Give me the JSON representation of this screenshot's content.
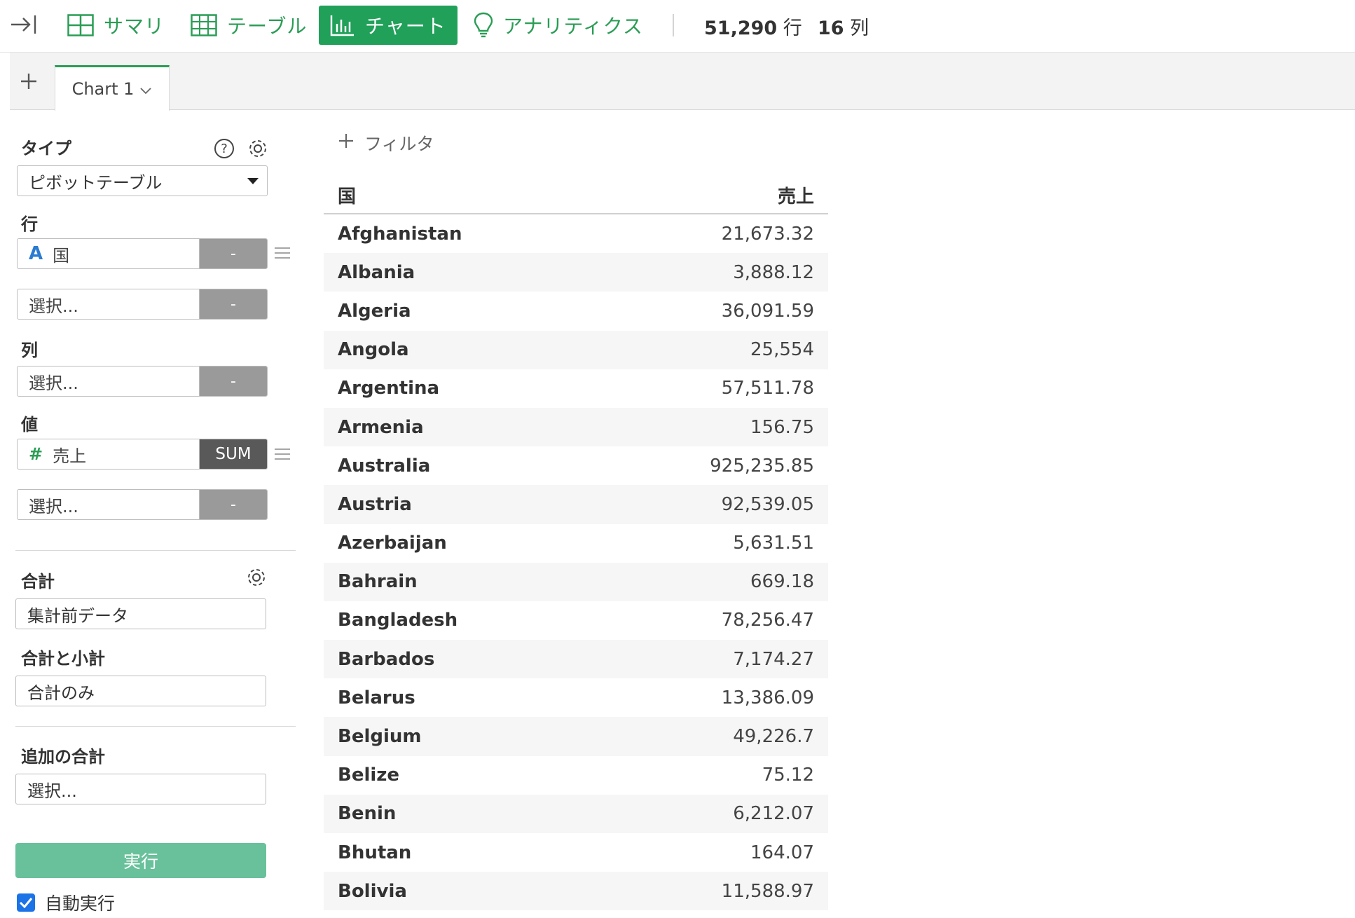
{
  "toolbar": {
    "nav": [
      {
        "label": "サマリ",
        "icon": "summary-grid-icon"
      },
      {
        "label": "テーブル",
        "icon": "table-grid-icon"
      },
      {
        "label": "チャート",
        "icon": "bar-chart-icon"
      },
      {
        "label": "アナリティクス",
        "icon": "lightbulb-icon"
      }
    ],
    "rows_count": "51,290",
    "rows_unit": "行",
    "cols_count": "16",
    "cols_unit": "列",
    "accent_color": "#21a05a"
  },
  "tabs": {
    "active_label": "Chart 1"
  },
  "panel": {
    "type_label": "タイプ",
    "type_value": "ピボットテーブル",
    "rows_label": "行",
    "row_field": {
      "name": "国",
      "type_glyph": "A",
      "agg": "-"
    },
    "row_empty": {
      "placeholder": "選択...",
      "agg": "-"
    },
    "cols_label": "列",
    "col_empty": {
      "placeholder": "選択...",
      "agg": "-"
    },
    "values_label": "値",
    "value_field": {
      "name": "売上",
      "type_glyph": "#",
      "agg": "SUM"
    },
    "value_empty": {
      "placeholder": "選択...",
      "agg": "-"
    },
    "total_label": "合計",
    "total_value": "集計前データ",
    "subtotal_label": "合計と小計",
    "subtotal_value": "合計のみ",
    "extra_total_label": "追加の合計",
    "extra_total_placeholder": "選択...",
    "run_label": "実行",
    "auto_run_label": "自動実行",
    "auto_run_checked": true
  },
  "main": {
    "filter_label": "フィルタ",
    "table": {
      "headers": [
        "国",
        "売上"
      ],
      "rows": [
        [
          "Afghanistan",
          "21,673.32"
        ],
        [
          "Albania",
          "3,888.12"
        ],
        [
          "Algeria",
          "36,091.59"
        ],
        [
          "Angola",
          "25,554"
        ],
        [
          "Argentina",
          "57,511.78"
        ],
        [
          "Armenia",
          "156.75"
        ],
        [
          "Australia",
          "925,235.85"
        ],
        [
          "Austria",
          "92,539.05"
        ],
        [
          "Azerbaijan",
          "5,631.51"
        ],
        [
          "Bahrain",
          "669.18"
        ],
        [
          "Bangladesh",
          "78,256.47"
        ],
        [
          "Barbados",
          "7,174.27"
        ],
        [
          "Belarus",
          "13,386.09"
        ],
        [
          "Belgium",
          "49,226.7"
        ],
        [
          "Belize",
          "75.12"
        ],
        [
          "Benin",
          "6,212.07"
        ],
        [
          "Bhutan",
          "164.07"
        ],
        [
          "Bolivia",
          "11,588.97"
        ]
      ]
    }
  }
}
